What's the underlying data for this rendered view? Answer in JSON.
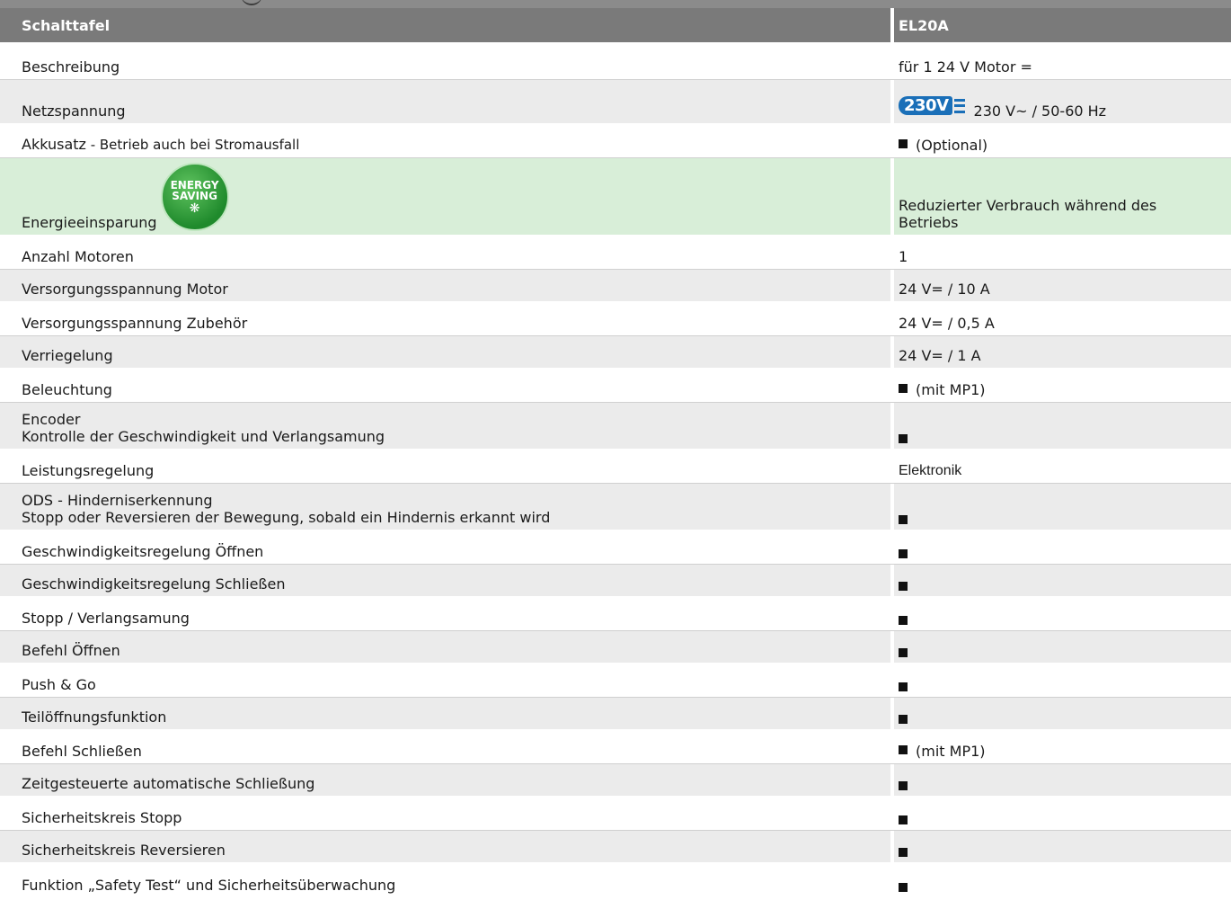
{
  "header": {
    "col1": "Schalttafel",
    "col2": "EL20A"
  },
  "icons": {
    "plug_label": "230V",
    "energy_line1": "ENERGY",
    "energy_line2": "SAVING",
    "energy_symbol": "❋"
  },
  "rows": [
    {
      "label": "Beschreibung",
      "value": "für 1 24 V Motor ="
    },
    {
      "label": "Netzspannung",
      "value": "230 V~ / 50-60 Hz"
    },
    {
      "label": "Akkusatz",
      "label_suffix": " - Betrieb auch bei Stromausfall",
      "value": "(Optional)"
    },
    {
      "label": "Energieeinsparung",
      "value": "Reduzierter Verbrauch während des Betriebs"
    },
    {
      "label": "Anzahl Motoren",
      "value": "1"
    },
    {
      "label": "Versorgungsspannung Motor",
      "value": "24 V= / 10 A"
    },
    {
      "label": "Versorgungsspannung Zubehör",
      "value": "24 V= / 0,5 A"
    },
    {
      "label": "Verriegelung",
      "value": "24 V= / 1 A"
    },
    {
      "label": "Beleuchtung",
      "value": "(mit MP1)"
    },
    {
      "label": "Encoder",
      "sublabel": "Kontrolle der Geschwindigkeit und Verlangsamung",
      "value": ""
    },
    {
      "label": "Leistungsregelung",
      "value": "Elektronik"
    },
    {
      "label": "ODS - Hinderniserkennung",
      "sublabel": "Stopp oder Reversieren der Bewegung, sobald ein Hindernis erkannt wird",
      "value": ""
    },
    {
      "label": "Geschwindigkeitsregelung Öffnen",
      "value": ""
    },
    {
      "label": "Geschwindigkeitsregelung Schließen",
      "value": ""
    },
    {
      "label": "Stopp / Verlangsamung",
      "value": ""
    },
    {
      "label": "Befehl Öffnen",
      "value": ""
    },
    {
      "label": "Push & Go",
      "value": ""
    },
    {
      "label": "Teilöffnungsfunktion",
      "value": ""
    },
    {
      "label": "Befehl Schließen",
      "value": "(mit MP1)"
    },
    {
      "label": "Zeitgesteuerte automatische Schließung",
      "value": ""
    },
    {
      "label": "Sicherheitskreis Stopp",
      "value": ""
    },
    {
      "label": "Sicherheitskreis Reversieren",
      "value": ""
    },
    {
      "label": "Funktion „Safety Test“ und Sicherheitsüberwachung",
      "value": ""
    }
  ]
}
